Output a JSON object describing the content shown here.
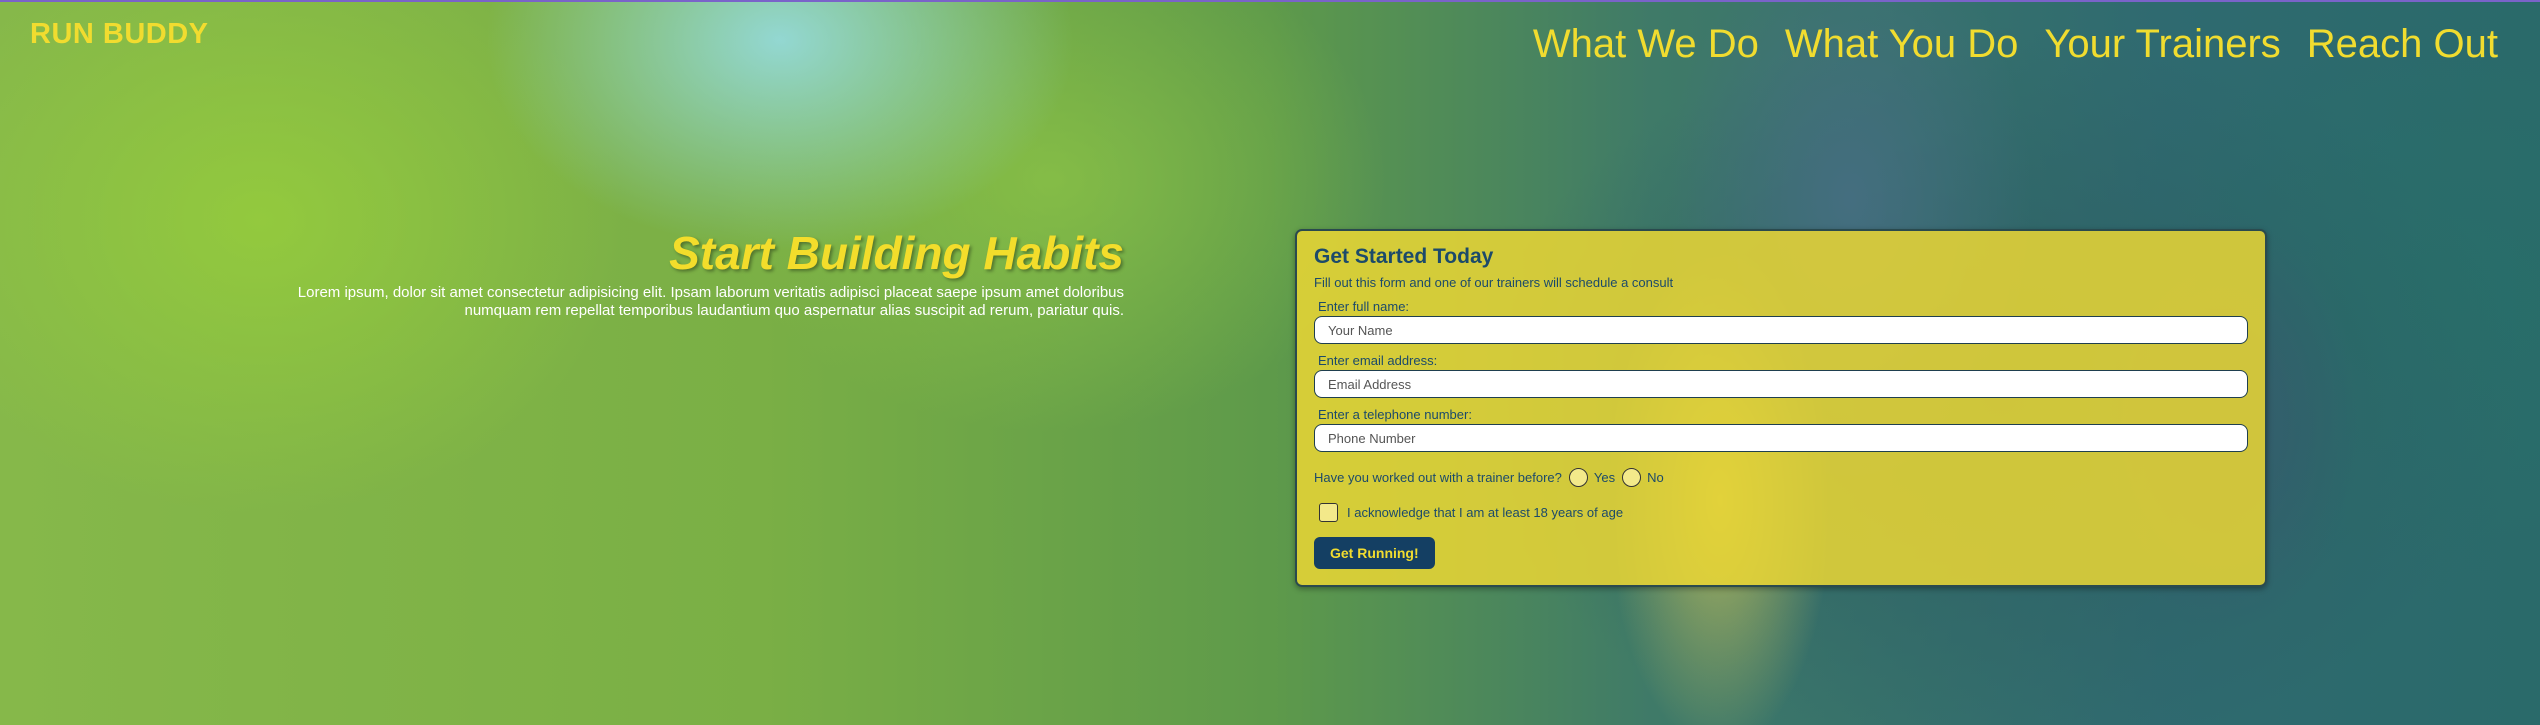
{
  "site": {
    "logo": "RUN BUDDY"
  },
  "nav": {
    "items": [
      "What We Do",
      "What You Do",
      "Your Trainers",
      "Reach Out"
    ]
  },
  "hero": {
    "heading": "Start Building Habits",
    "body": "Lorem ipsum, dolor sit amet consectetur adipisicing elit. Ipsam laborum veritatis adipisci placeat saepe ipsum amet doloribus numquam rem repellat temporibus laudantium quo aspernatur alias suscipit ad rerum, pariatur quis."
  },
  "form": {
    "title": "Get Started Today",
    "subtitle": "Fill out this form and one of our trainers will schedule a consult",
    "name_label": "Enter full name:",
    "name_placeholder": "Your Name",
    "email_label": "Enter email address:",
    "email_placeholder": "Email Address",
    "phone_label": "Enter a telephone number:",
    "phone_placeholder": "Phone Number",
    "trainer_question": "Have you worked out with a trainer before?",
    "yes_label": "Yes",
    "no_label": "No",
    "age_ack": "I acknowledge that I am at least 18 years of age",
    "submit_label": "Get Running!"
  },
  "colors": {
    "accent_yellow": "#f1dc2f",
    "button_blue": "#143f63",
    "text_blue": "#1c4a6a"
  }
}
